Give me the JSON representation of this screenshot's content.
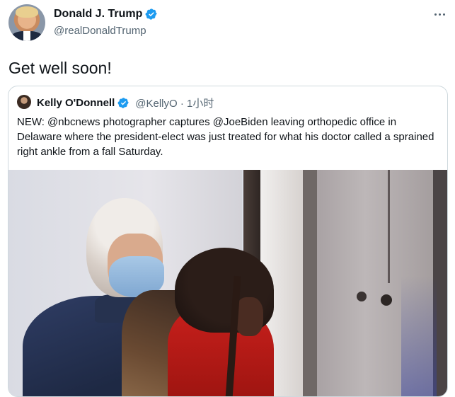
{
  "tweet": {
    "author_name": "Donald J. Trump",
    "author_handle": "@realDonaldTrump",
    "text": "Get well soon!",
    "avatar_icon": "profile-photo",
    "verified_icon": "verified-badge-icon",
    "more_icon": "more-options-icon"
  },
  "quoted_tweet": {
    "author_name": "Kelly O'Donnell",
    "meta": "@KellyO · 1小时",
    "text": "NEW:  @nbcnews photographer captures @JoeBiden leaving orthopedic office in Delaware where the president-elect was just treated for what his doctor called a sprained right ankle from a fall Saturday.",
    "media": "photo"
  },
  "colors": {
    "verified": "#1d9bf0",
    "secondary_text": "#536471",
    "border": "#cfd9de",
    "primary_text": "#0f1419"
  }
}
